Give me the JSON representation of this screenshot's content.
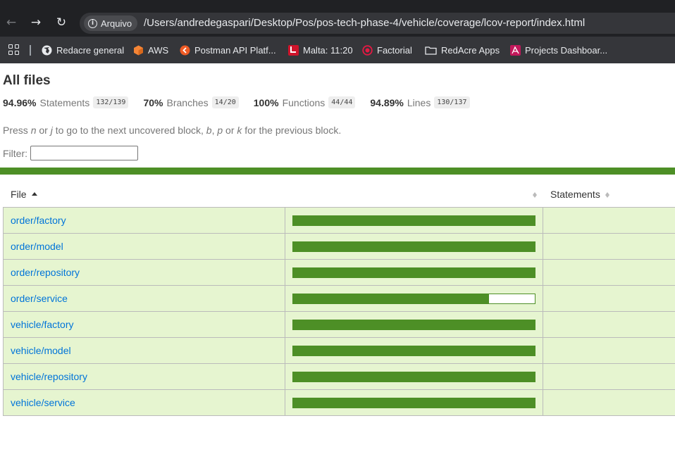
{
  "browser": {
    "address_chip": "Arquivo",
    "url": "/Users/andredegaspari/Desktop/Pos/pos-tech-phase-4/vehicle/coverage/lcov-report/index.html",
    "nav": {
      "back": "←",
      "forward": "→",
      "reload": "↻"
    }
  },
  "bookmarks": [
    {
      "label": "Redacre general",
      "icon": "globe-icon"
    },
    {
      "label": "AWS",
      "icon": "aws-cube-icon"
    },
    {
      "label": "Postman API Platf...",
      "icon": "postman-icon"
    },
    {
      "label": "Malta: 11:20",
      "icon": "malta-flag-icon"
    },
    {
      "label": "Factorial",
      "icon": "factorial-icon"
    },
    {
      "label": "RedAcre Apps",
      "icon": "folder-icon"
    },
    {
      "label": "Projects Dashboar...",
      "icon": "projects-icon"
    }
  ],
  "page": {
    "title": "All files",
    "summary": [
      {
        "pct": "94.96%",
        "label": "Statements",
        "fraction": "132/139"
      },
      {
        "pct": "70%",
        "label": "Branches",
        "fraction": "14/20"
      },
      {
        "pct": "100%",
        "label": "Functions",
        "fraction": "44/44"
      },
      {
        "pct": "94.89%",
        "label": "Lines",
        "fraction": "130/137"
      }
    ],
    "hint": {
      "p1": "Press ",
      "k1": "n",
      "p2": " or ",
      "k2": "j",
      "p3": " to go to the next uncovered block, ",
      "k3": "b",
      "p4": ", ",
      "k4": "p",
      "p5": " or ",
      "k5": "k",
      "p6": " for the previous block."
    },
    "filter_label": "Filter:",
    "filter_value": ""
  },
  "table": {
    "headers": {
      "file": "File",
      "statements": "Statements"
    },
    "rows": [
      {
        "file": "order/factory",
        "coverage": 1.0
      },
      {
        "file": "order/model",
        "coverage": 1.0
      },
      {
        "file": "order/repository",
        "coverage": 1.0
      },
      {
        "file": "order/service",
        "coverage": 0.81
      },
      {
        "file": "vehicle/factory",
        "coverage": 1.0
      },
      {
        "file": "vehicle/model",
        "coverage": 1.0
      },
      {
        "file": "vehicle/repository",
        "coverage": 1.0
      },
      {
        "file": "vehicle/service",
        "coverage": 1.0
      }
    ]
  },
  "colors": {
    "high": "#4d8f26",
    "row_bg": "#e6f5d0",
    "link": "#0074d9"
  }
}
